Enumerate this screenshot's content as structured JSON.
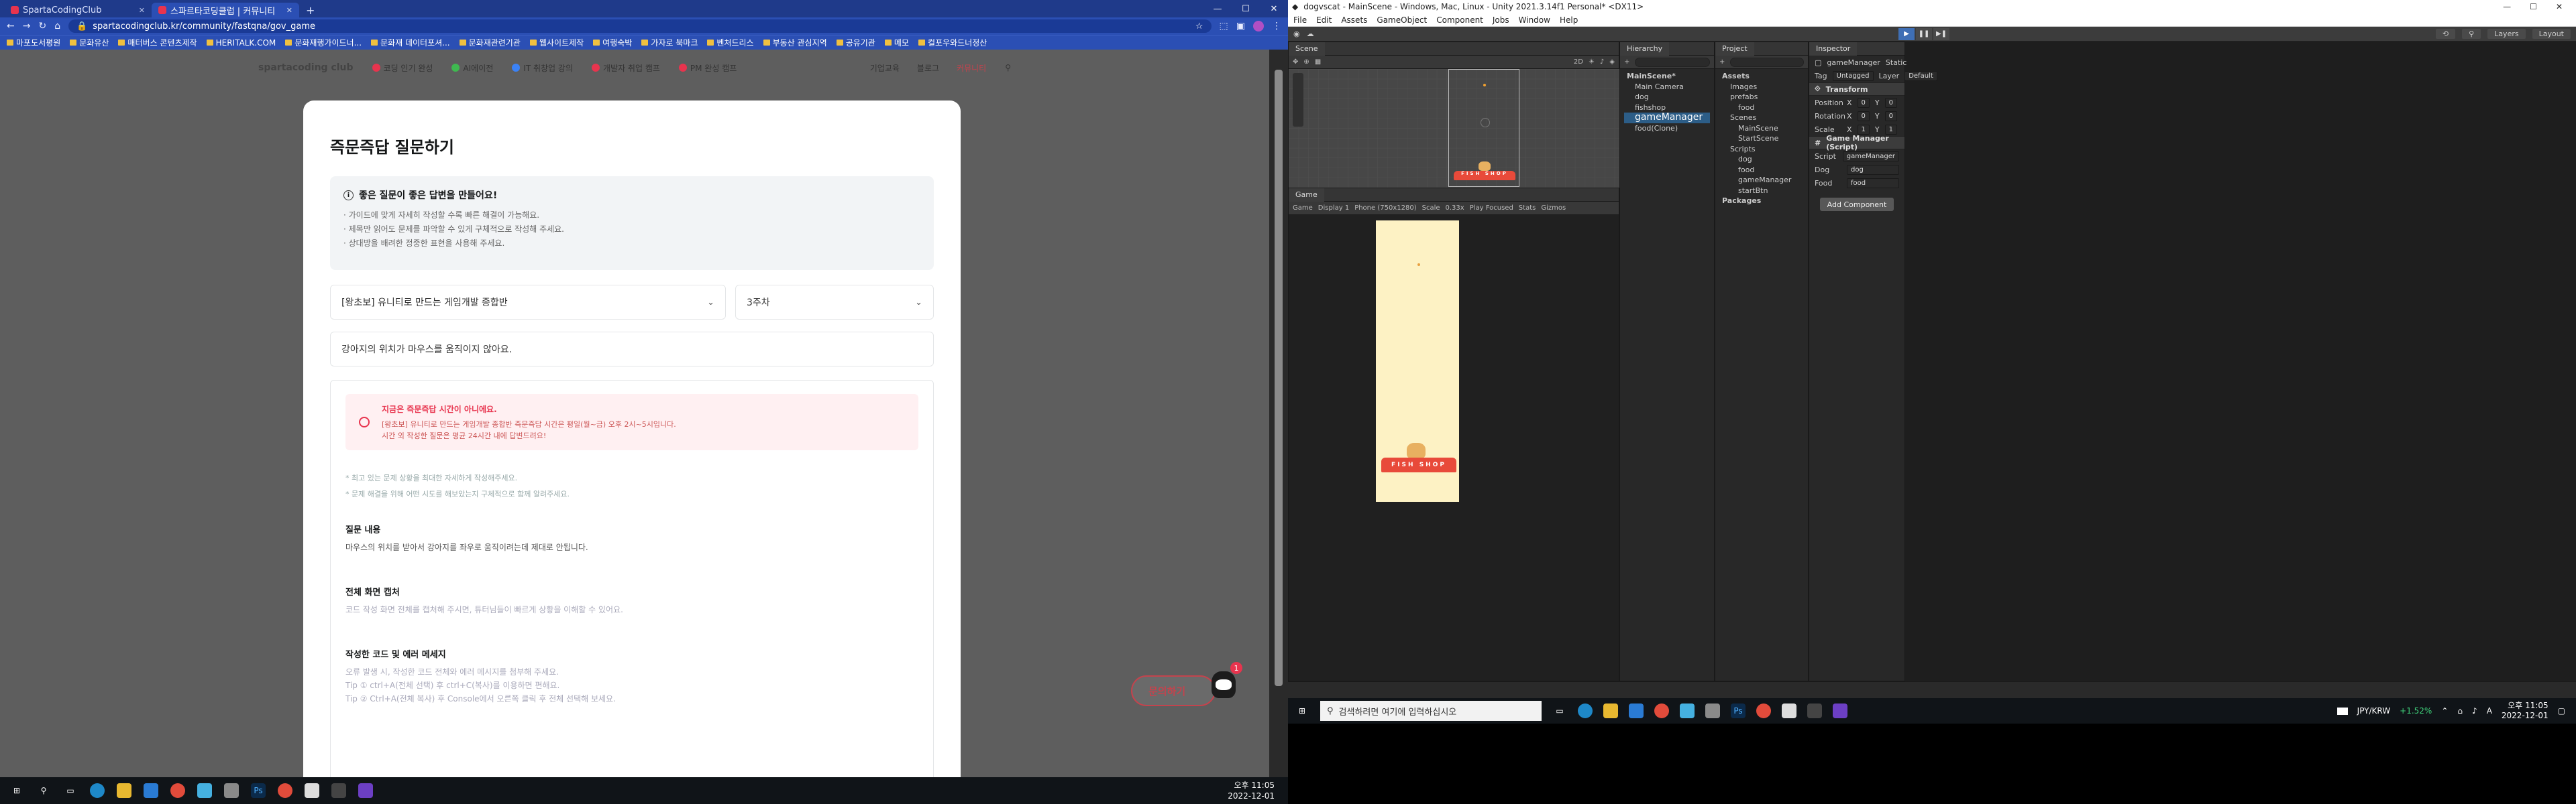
{
  "browser": {
    "tabs": [
      {
        "title": "SpartaCodingClub",
        "active": false
      },
      {
        "title": "스파르타코딩클럽 | 커뮤니티",
        "active": true
      }
    ],
    "new_tab": "+",
    "url": "spartacodingclub.kr/community/fastqna/gov_game",
    "bookmarks": [
      "마포도서평원",
      "문화유산",
      "매터버스 콘텐츠제작",
      "HERITALK.COM",
      "문화재행가이드너...",
      "문화재 데이터포셔...",
      "문화재관련기관",
      "웹사이트제작",
      "여행숙박",
      "가자로 북마크",
      "벤처드리스",
      "부동산 관심지역",
      "공유기관",
      "메모",
      "컬포우와드너정산"
    ]
  },
  "site": {
    "logo": "spartacoding club",
    "nav": [
      "코딩 인기 완성",
      "AI에이전",
      "IT 취창업 강의",
      "개발자 취업 캠프",
      "PM 완성 캠프"
    ],
    "right": [
      "기업교육",
      "블로그",
      "커뮤니티"
    ]
  },
  "modal": {
    "title": "즉문즉답 질문하기",
    "info_title": "좋은 질문이 좋은 답변을 만들어요!",
    "info_lines": [
      "· 가이드에 맞게 자세히 작성할 수록 빠른 해결이 가능해요.",
      "· 제목만 읽어도 문제를 파악할 수 있게 구체적으로 작성해 주세요.",
      "· 상대방을 배려한 정중한 표현을 사용해 주세요."
    ],
    "course": "[왕초보] 유니티로 만드는 게임개발 종합반",
    "week": "3주차",
    "question_title": "강아지의 위치가 마우스를 움직이지 않아요.",
    "alert_title": "지금은 즉문즉답 시간이 아니에요.",
    "alert_lines": [
      "[왕초보] 유니티로 만드는 게임개발 종합반 즉문즉답 시간은 평일(월~금) 오후 2시~5시입니다.",
      "시간 외 작성한 질문은 평균 24시간 내에 답변드려요!"
    ],
    "notes": [
      "* 최고 있는 문제 상황을 최대한 자세하게 작성해주세요.",
      "* 문제 해결을 위해 어떤 시도를 해보았는지 구체적으로 함께 알려주세요."
    ],
    "sections": [
      {
        "title": "질문 내용",
        "lines": [
          "마우스의 위치를 받아서 강아지를 좌우로 움직이려는데 제대로 안됩니다."
        ],
        "muted": false
      },
      {
        "title": "전체 화면 캡처",
        "lines": [
          "코드 작성 화면 전체를 캡처해 주시면, 튜터님들이 빠르게 상황을 이해할 수 있어요."
        ],
        "muted": true
      },
      {
        "title": "작성한 코드 및 에러 메세지",
        "lines": [
          "오류 발생 시, 작성한 코드 전체와 에러 메시지를 첨부해 주세요.",
          "Tip ① ctrl+A(전체 선택) 후 ctrl+C(복사)를 이용하면 편해요.",
          "Tip ② Ctrl+A(전체 복사) 후 Console에서 오른쪽 클릭 후 전체 선택해 보세요."
        ],
        "muted": true
      }
    ],
    "fab": "문의하기",
    "badge": "1"
  },
  "taskbar1": {
    "time": "오후 11:05",
    "date": "2022-12-01"
  },
  "unity": {
    "title": "dogvscat - MainScene - Windows, Mac, Linux - Unity 2021.3.14f1 Personal* <DX11>",
    "menu": [
      "File",
      "Edit",
      "Assets",
      "GameObject",
      "Component",
      "Jobs",
      "Window",
      "Help"
    ],
    "toolbar_right": [
      "Layers",
      "Layout"
    ],
    "scene_tab": "Scene",
    "hierarchy_tab": "Hierarchy",
    "hierarchy": [
      {
        "name": "MainScene*",
        "level": 0,
        "bold": true
      },
      {
        "name": "Main Camera",
        "level": 1
      },
      {
        "name": "dog",
        "level": 1
      },
      {
        "name": "fishshop",
        "level": 1
      },
      {
        "name": "gameManager",
        "level": 1,
        "selected": true
      },
      {
        "name": "food(Clone)",
        "level": 1
      }
    ],
    "project_tab": "Project",
    "project": [
      {
        "name": "Assets",
        "level": 0,
        "bold": true
      },
      {
        "name": "Images",
        "level": 1
      },
      {
        "name": "prefabs",
        "level": 1
      },
      {
        "name": "food",
        "level": 2
      },
      {
        "name": "Scenes",
        "level": 1
      },
      {
        "name": "MainScene",
        "level": 2
      },
      {
        "name": "StartScene",
        "level": 2
      },
      {
        "name": "Scripts",
        "level": 1
      },
      {
        "name": "dog",
        "level": 2
      },
      {
        "name": "food",
        "level": 2
      },
      {
        "name": "gameManager",
        "level": 2
      },
      {
        "name": "startBtn",
        "level": 2
      },
      {
        "name": "Packages",
        "level": 0,
        "bold": true
      }
    ],
    "inspector_tab": "Inspector",
    "object_name": "gameManager",
    "static": "Static",
    "tag": "Untagged",
    "layer": "Default",
    "transform": "Transform",
    "position": [
      "0",
      "0",
      "0"
    ],
    "rotation": [
      "0",
      "0",
      "0"
    ],
    "scale": [
      "1",
      "1",
      "1"
    ],
    "script_component": "Game Manager (Script)",
    "fields": [
      {
        "label": "Script",
        "value": "gameManager"
      },
      {
        "label": "Dog",
        "value": "dog"
      },
      {
        "label": "Food",
        "value": "food"
      }
    ],
    "add_component": "Add Component",
    "game_tab": "Game",
    "game_bar": [
      "Game",
      "Display 1",
      "Phone (750x1280)",
      "Scale",
      "0.33x",
      "Play Focused",
      "Stats",
      "Gizmos"
    ],
    "shop_text": "FISH SHOP"
  },
  "taskbar2": {
    "search": "검색하려면 여기에 입력하십시오",
    "currency": "JPY/KRW",
    "change": "+1.52%",
    "time": "오후 11:05",
    "date": "2022-12-01",
    "lang": "A"
  }
}
